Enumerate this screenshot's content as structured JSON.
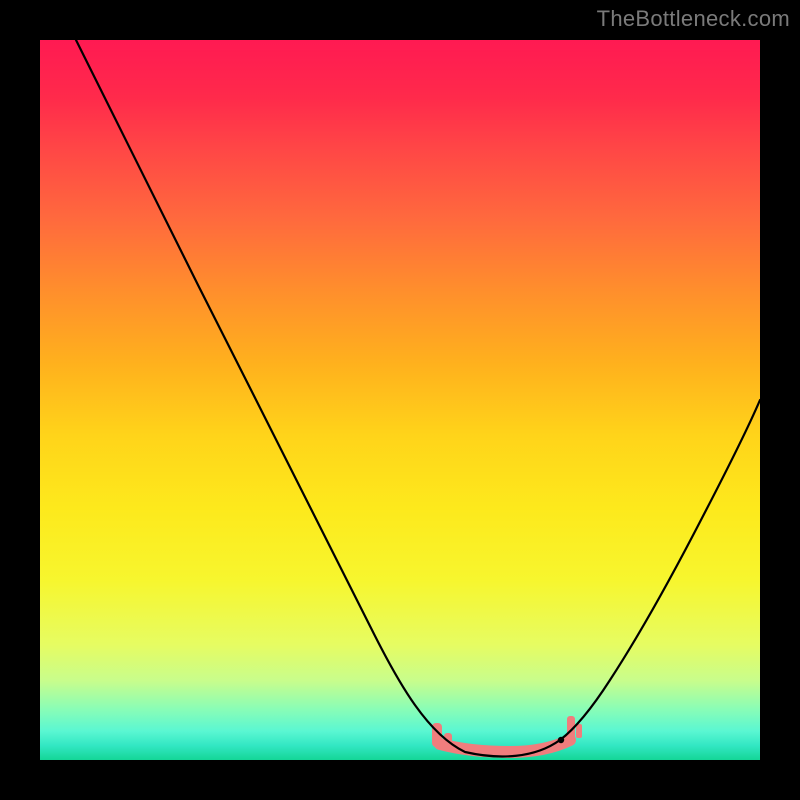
{
  "attribution": "TheBottleneck.com",
  "chart_data": {
    "type": "line",
    "title": "",
    "xlabel": "",
    "ylabel": "",
    "xlim": [
      0,
      100
    ],
    "ylim": [
      0,
      100
    ],
    "legend": false,
    "gradient": "red-to-green vertical",
    "series": [
      {
        "name": "bottleneck-curve",
        "color": "#000000",
        "x": [
          5,
          9,
          15,
          22,
          30,
          38,
          46,
          52,
          56,
          59,
          62,
          66,
          70,
          74,
          78,
          83,
          88,
          93,
          97,
          100
        ],
        "y": [
          100,
          92,
          80,
          66,
          50,
          34,
          18,
          8,
          3,
          1,
          0.5,
          0.5,
          1,
          3,
          8,
          16,
          26,
          36,
          44,
          50
        ]
      }
    ],
    "highlight": {
      "name": "optimal-range",
      "color": "#f07d7d",
      "x_range": [
        55,
        74
      ],
      "y": 1
    },
    "annotations": [
      {
        "name": "min-marker",
        "x": 72,
        "y": 2.5,
        "color": "#000000"
      }
    ]
  }
}
